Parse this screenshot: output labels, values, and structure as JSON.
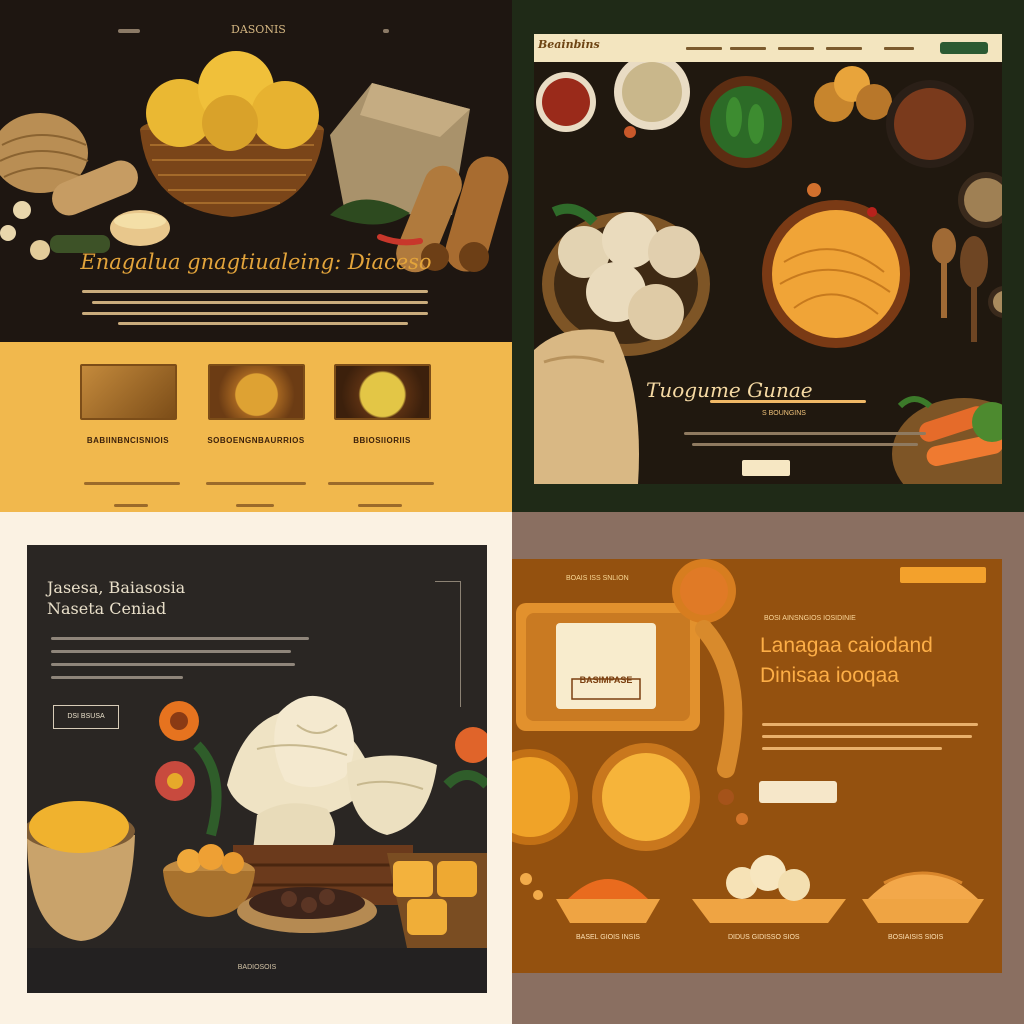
{
  "panel_1": {
    "nav": {
      "logo_mark": "",
      "title": "DASONIS"
    },
    "hero_title": "Enagalua gnagtiualeing: Diaceso",
    "cards": [
      {
        "title": "BABIINBNCISNIOIS"
      },
      {
        "title": "SOBOENGNBAURRIOS"
      },
      {
        "title": "BBIOSIIORIIS"
      }
    ],
    "colors": {
      "background": "#1e1611",
      "band": "#f1b84d",
      "accent": "#e3a43b"
    }
  },
  "panel_2": {
    "logo": "Beainbins",
    "hero_title": "Tuogume Gunae",
    "subtitle": "S BOUNGINS",
    "colors": {
      "frame": "#20180f",
      "nav": "#f3e5bf",
      "button": "#2b5a32"
    }
  },
  "panel_3": {
    "heading_line_1": "Jasesa, Baiasosia",
    "heading_line_2": "Naseta Ceniad",
    "button_label": "DSI BSUSA",
    "footer_text": "BADIOSOIS",
    "colors": {
      "panel": "#2a2623",
      "text": "#e9dfc9"
    }
  },
  "panel_4": {
    "top_tag": "BOAIS ISS SNLION",
    "kicker": "BOSI AINSNGIOS IOSIDINIE",
    "title_line_1": "Lanagaa caiodand",
    "title_line_2": "Dinisaa iooqaa",
    "package_label": "BASIMPASE",
    "product_labels": [
      "BASEL GIOIS INSIS",
      "DIDUS GIDISSO SIOS",
      "BOSIAISIS SIOIS"
    ],
    "colors": {
      "board": "#94510f",
      "title": "#fdae46",
      "pill": "#f3a12c"
    }
  }
}
